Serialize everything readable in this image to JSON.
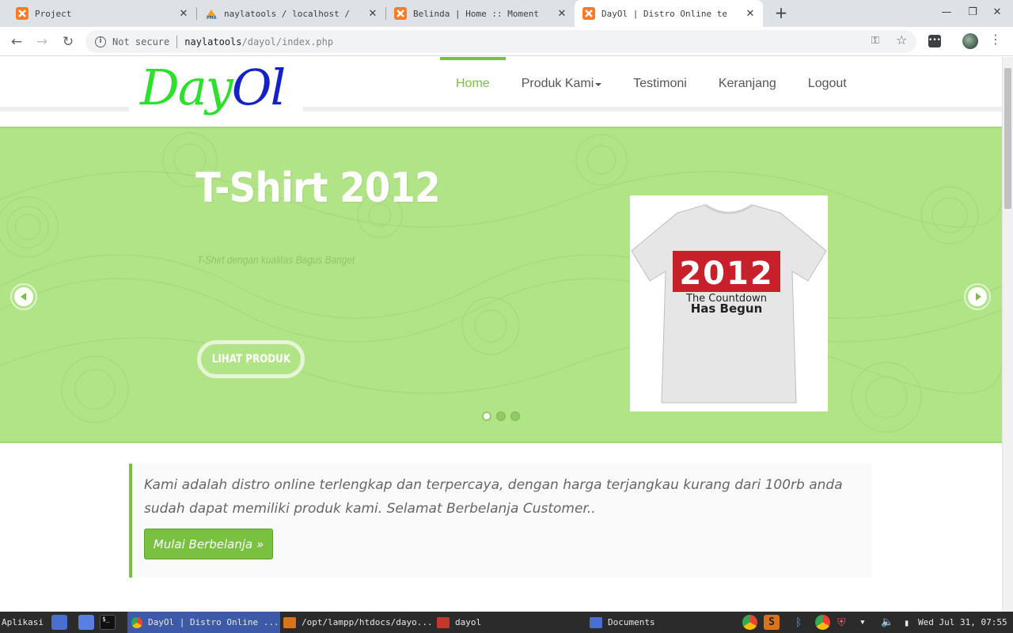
{
  "browser": {
    "tabs": [
      {
        "title": "Project",
        "active": false
      },
      {
        "title": "naylatools / localhost /",
        "active": false
      },
      {
        "title": "Belinda | Home :: Moment",
        "active": false
      },
      {
        "title": "DayOl | Distro Online te",
        "active": true
      }
    ],
    "new_tab_label": "+",
    "security_label": "Not secure",
    "url_host": "naylatools",
    "url_path": "/dayol/index.php"
  },
  "site": {
    "logo_part1": "Day",
    "logo_part2": "Ol",
    "nav": [
      {
        "label": "Home",
        "active": true
      },
      {
        "label": "Produk Kami",
        "dropdown": true
      },
      {
        "label": "Testimoni"
      },
      {
        "label": "Keranjang"
      },
      {
        "label": "Logout"
      }
    ],
    "slider": {
      "title": "T-Shirt 2012",
      "description": "T-Shirt dengan kualitas Bagus Banget",
      "button_label": "LIHAT PRODUK",
      "image_text_big": "2012",
      "image_text_line1": "The Countdown",
      "image_text_line2": "Has Begun",
      "slides_total": 3,
      "slide_active_index": 0
    },
    "welcome": {
      "text": "Kami adalah distro online terlengkap dan terpercaya, dengan harga terjangkau kurang dari 100rb anda sudah dapat memiliki produk kami. Selamat Berbelanja Customer..",
      "button_label": "Mulai Berbelanja »"
    }
  },
  "taskbar": {
    "start_label": "Aplikasi",
    "items": [
      {
        "label": "DayOl | Distro Online ..."
      },
      {
        "label": "/opt/lampp/htdocs/dayo..."
      },
      {
        "label": "dayol"
      },
      {
        "label": "Documents"
      }
    ],
    "clock": "Wed Jul 31, 07:55"
  },
  "colors": {
    "accent_green": "#7ac142",
    "slider_bg": "#b1e487",
    "logo_green": "#2ee02e",
    "logo_blue": "#1420c8"
  }
}
